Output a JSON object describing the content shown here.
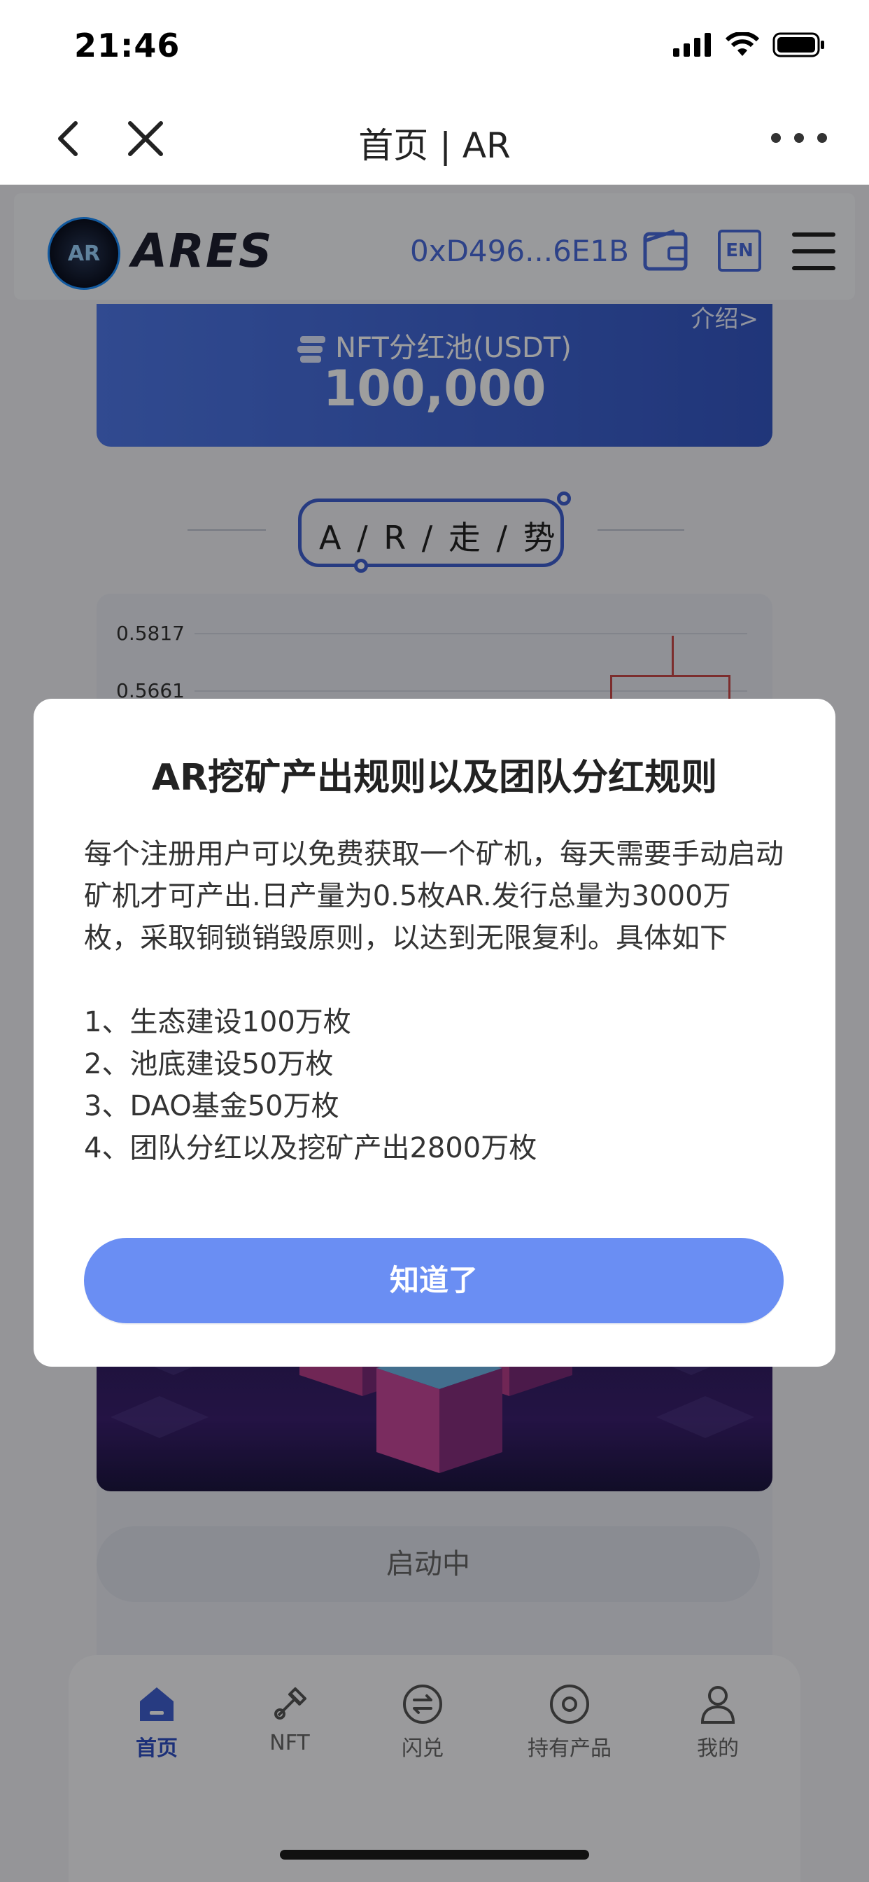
{
  "status_bar": {
    "time": "21:46"
  },
  "nav": {
    "title": "首页 | AR"
  },
  "header": {
    "logo_text": "ARES",
    "logo_badge": "AR",
    "wallet_address": "0xD496...6E1B",
    "lang": "EN"
  },
  "nft_pool": {
    "intro_link": "介绍>",
    "label": "NFT分红池(USDT)",
    "value": "100,000"
  },
  "trend": {
    "title": "A / R / 走 / 势"
  },
  "chart": {
    "ticks": [
      "0.5817",
      "0.5661"
    ]
  },
  "chart_data": {
    "type": "candlestick",
    "y_ticks": [
      0.5817,
      0.5661
    ]
  },
  "mining": {
    "status_button": "启动中"
  },
  "bottom_nav": {
    "tabs": [
      {
        "label": "首页",
        "icon": "home-icon",
        "active": true
      },
      {
        "label": "NFT",
        "icon": "nft-icon",
        "active": false
      },
      {
        "label": "闪兑",
        "icon": "swap-icon",
        "active": false
      },
      {
        "label": "持有产品",
        "icon": "holding-icon",
        "active": false
      },
      {
        "label": "我的",
        "icon": "user-icon",
        "active": false
      }
    ]
  },
  "dialog": {
    "title": "AR挖矿产出规则以及团队分红规则",
    "body": "每个注册用户可以免费获取一个矿机，每天需要手动启动矿机才可产出.日产量为0.5枚AR.发行总量为3000万枚，采取铜锁销毁原则，以达到无限复利。具体如下",
    "items": [
      "1、生态建设100万枚",
      "2、池底建设50万枚",
      "3、DAO基金50万枚",
      "4、团队分红以及挖矿产出2800万枚"
    ],
    "confirm": "知道了"
  },
  "colors": {
    "accent": "#4a6bdc",
    "button": "#6a8ef3",
    "candle": "#c84a4a"
  }
}
